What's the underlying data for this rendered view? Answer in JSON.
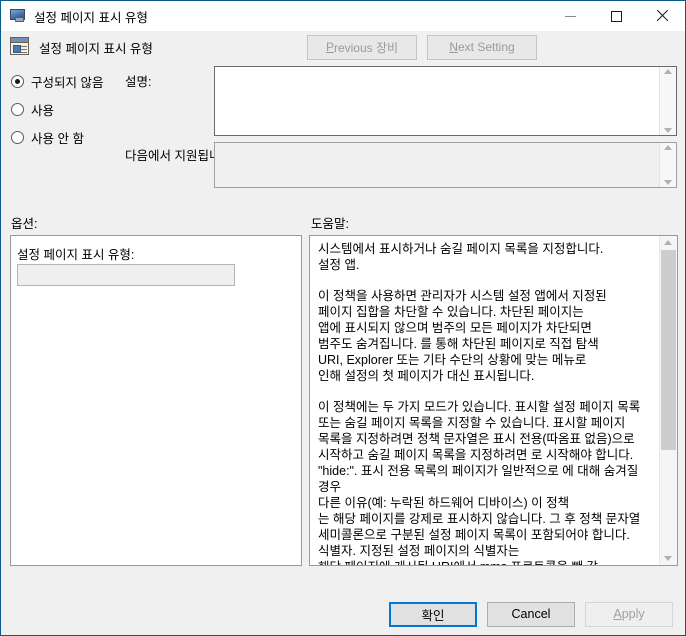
{
  "window": {
    "title": "설정 페이지 표시 유형",
    "controls": {
      "minimize": "minimize",
      "maximize": "maximize",
      "close": "close"
    }
  },
  "header": {
    "title": "설정 페이지 표시 유형",
    "previous_button": {
      "accel": "P",
      "rest": "revious 장비"
    },
    "next_button": {
      "accel": "N",
      "rest": "ext Setting"
    }
  },
  "state": {
    "options": [
      {
        "label": "구성되지 않음",
        "selected": true
      },
      {
        "label": "사용",
        "selected": false
      },
      {
        "label": "사용 안 함",
        "selected": false
      }
    ]
  },
  "labels": {
    "comment": "설명:",
    "supported_on": "다음에서 지원됩니다:",
    "options": "옵션:",
    "help": "도움말:"
  },
  "fields": {
    "comment_value": "",
    "supported_on_value": ""
  },
  "options_panel": {
    "setting_label": "설정 페이지 표시 유형:",
    "setting_value": ""
  },
  "help": {
    "paragraphs": [
      "시스템에서 표시하거나 숨길 페이지 목록을 지정합니다.\n설정 앱.",
      "이 정책을 사용하면 관리자가 시스템 설정 앱에서 지정된\n페이지 집합을 차단할 수 있습니다. 차단된 페이지는\n앱에 표시되지 않으며 범주의 모든 페이지가 차단되면\n범주도 숨겨집니다. 를 통해 차단된 페이지로 직접 탐색\nURI, Explorer 또는 기타 수단의 상황에 맞는 메뉴로\n인해 설정의 첫 페이지가 대신 표시됩니다.",
      "이 정책에는 두 가지 모드가 있습니다. 표시할 설정 페이지 목록\n또는 숨길 페이지 목록을 지정할 수 있습니다. 표시할 페이지\n목록을 지정하려면 정책 문자열은 표시 전용(따옴표 없음)으로\n시작하고 숨길 페이지 목록을 지정하려면 로 시작해야 합니다.\n\"hide:\". 표시 전용 목록의 페이지가 일반적으로 에 대해 숨겨질 경우\n다른 이유(예: 누락된 하드웨어 디바이스) 이 정책\n는 해당 페이지를 강제로 표시하지 않습니다. 그 후 정책 문자열\n세미콜론으로 구분된 설정 페이지 목록이 포함되어야 합니다.\n식별자. 지정된 설정 페이지의 식별자는\n해당 페이지에 게시된 URI에서 mms 프로토콜을 뺀 값\n부분."
    ]
  },
  "footer": {
    "ok": "확인",
    "cancel": "Cancel",
    "apply": {
      "accel": "A",
      "rest": "pply"
    }
  }
}
